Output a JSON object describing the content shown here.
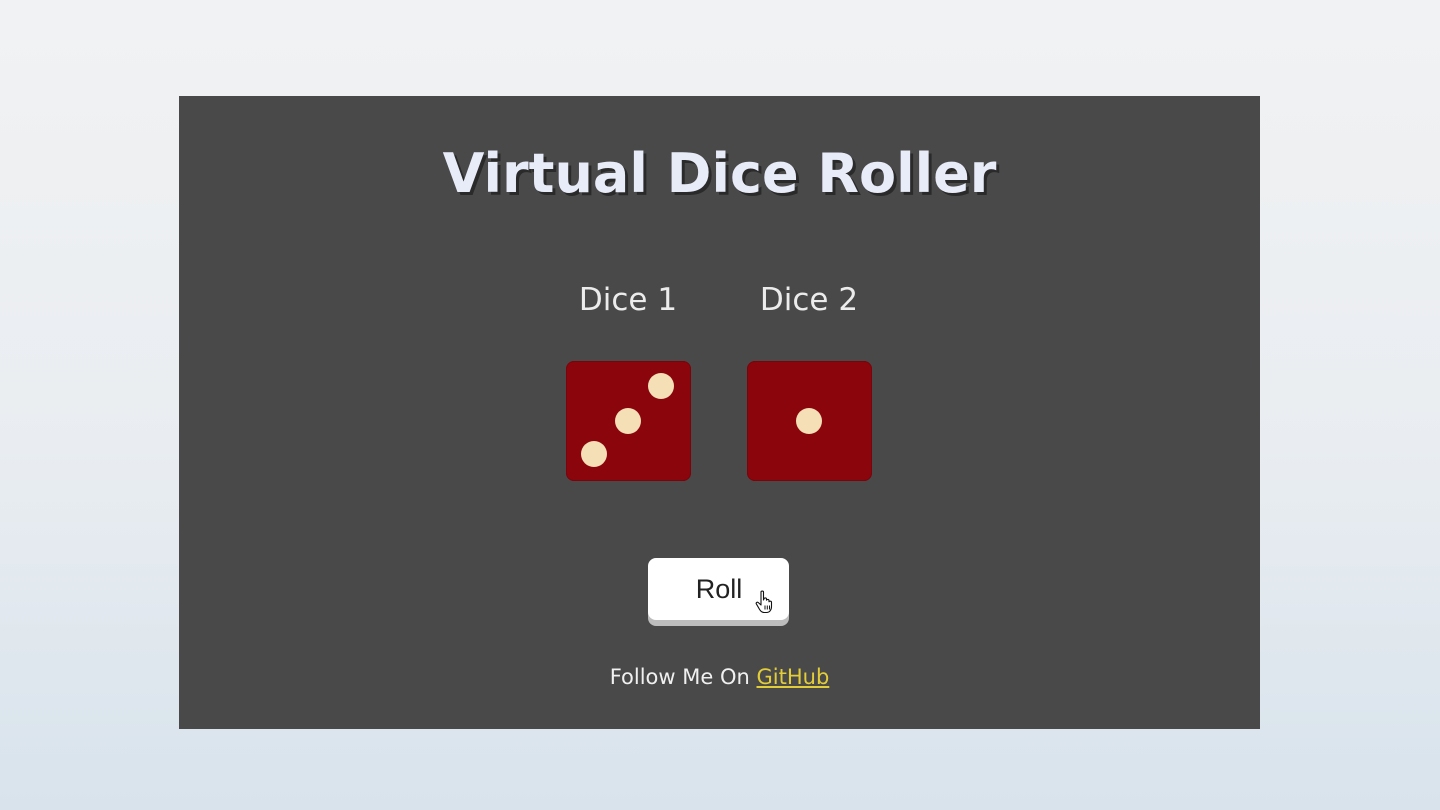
{
  "app": {
    "title": "Virtual Dice Roller"
  },
  "dice": [
    {
      "label": "Dice 1",
      "value": 3
    },
    {
      "label": "Dice 2",
      "value": 1
    }
  ],
  "controls": {
    "roll_label": "Roll"
  },
  "footer": {
    "prefix": "Follow Me On",
    "link_label": "GitHub"
  },
  "colors": {
    "panel": "#494949",
    "die_face": "#8b050d",
    "pip": "#f5dfb7",
    "title": "#e8ecf8",
    "link": "#e2cd39",
    "button": "#ffffff"
  },
  "icons": {
    "cursor": "hand-pointer-icon"
  }
}
